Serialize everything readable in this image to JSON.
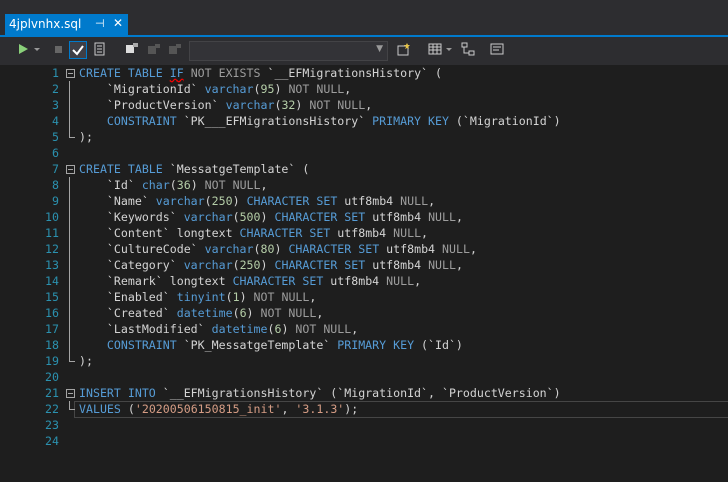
{
  "tab": {
    "title": "4jplvnhx.sql",
    "pin_glyph": "⊣",
    "close_glyph": "✕"
  },
  "toolbar": {
    "icons": [
      "run-icon",
      "run-dropdown-icon",
      "stop-icon",
      "validate-icon",
      "results-icon",
      "connect-icon",
      "disconnect-icon",
      "change-connection-icon",
      "database-combo",
      "new-query-icon",
      "results-grid-icon",
      "execution-plan-icon",
      "properties-icon"
    ],
    "database_combo_value": ""
  },
  "editor": {
    "lines": [
      {
        "n": "1",
        "fold": "start",
        "tokens": [
          [
            "kw",
            "CREATE TABLE "
          ],
          [
            "kw sq",
            "IF"
          ],
          [
            "gr",
            " NOT EXISTS "
          ],
          [
            "tx",
            "`__EFMigrationsHistory`"
          ],
          [
            "tx",
            " ("
          ]
        ]
      },
      {
        "n": "2",
        "fold": "mid",
        "tokens": [
          [
            "tx",
            "    `MigrationId` "
          ],
          [
            "kw",
            "varchar"
          ],
          [
            "tx",
            "("
          ],
          [
            "nm",
            "95"
          ],
          [
            "tx",
            ") "
          ],
          [
            "gr",
            "NOT NULL"
          ],
          [
            "tx",
            ","
          ]
        ]
      },
      {
        "n": "3",
        "fold": "mid",
        "tokens": [
          [
            "tx",
            "    `ProductVersion` "
          ],
          [
            "kw",
            "varchar"
          ],
          [
            "tx",
            "("
          ],
          [
            "nm",
            "32"
          ],
          [
            "tx",
            ") "
          ],
          [
            "gr",
            "NOT NULL"
          ],
          [
            "tx",
            ","
          ]
        ]
      },
      {
        "n": "4",
        "fold": "mid",
        "tokens": [
          [
            "kw",
            "    CONSTRAINT "
          ],
          [
            "tx",
            "`PK___EFMigrationsHistory` "
          ],
          [
            "kw",
            "PRIMARY KEY"
          ],
          [
            "tx",
            " (`MigrationId`)"
          ]
        ]
      },
      {
        "n": "5",
        "fold": "end",
        "tokens": [
          [
            "tx",
            ");"
          ]
        ]
      },
      {
        "n": "6",
        "fold": "",
        "tokens": []
      },
      {
        "n": "7",
        "fold": "start",
        "tokens": [
          [
            "kw",
            "CREATE TABLE "
          ],
          [
            "tx",
            "`MessatgeTemplate` ("
          ]
        ]
      },
      {
        "n": "8",
        "fold": "mid",
        "tokens": [
          [
            "tx",
            "    `Id` "
          ],
          [
            "kw",
            "char"
          ],
          [
            "tx",
            "("
          ],
          [
            "nm",
            "36"
          ],
          [
            "tx",
            ") "
          ],
          [
            "gr",
            "NOT NULL"
          ],
          [
            "tx",
            ","
          ]
        ]
      },
      {
        "n": "9",
        "fold": "mid",
        "tokens": [
          [
            "tx",
            "    `Name` "
          ],
          [
            "kw",
            "varchar"
          ],
          [
            "tx",
            "("
          ],
          [
            "nm",
            "250"
          ],
          [
            "tx",
            ") "
          ],
          [
            "kw",
            "CHARACTER SET"
          ],
          [
            "tx",
            " utf8mb4 "
          ],
          [
            "gr",
            "NULL"
          ],
          [
            "tx",
            ","
          ]
        ]
      },
      {
        "n": "10",
        "fold": "mid",
        "tokens": [
          [
            "tx",
            "    `Keywords` "
          ],
          [
            "kw",
            "varchar"
          ],
          [
            "tx",
            "("
          ],
          [
            "nm",
            "500"
          ],
          [
            "tx",
            ") "
          ],
          [
            "kw",
            "CHARACTER SET"
          ],
          [
            "tx",
            " utf8mb4 "
          ],
          [
            "gr",
            "NULL"
          ],
          [
            "tx",
            ","
          ]
        ]
      },
      {
        "n": "11",
        "fold": "mid",
        "tokens": [
          [
            "tx",
            "    `Content` longtext "
          ],
          [
            "kw",
            "CHARACTER SET"
          ],
          [
            "tx",
            " utf8mb4 "
          ],
          [
            "gr",
            "NULL"
          ],
          [
            "tx",
            ","
          ]
        ]
      },
      {
        "n": "12",
        "fold": "mid",
        "tokens": [
          [
            "tx",
            "    `CultureCode` "
          ],
          [
            "kw",
            "varchar"
          ],
          [
            "tx",
            "("
          ],
          [
            "nm",
            "80"
          ],
          [
            "tx",
            ") "
          ],
          [
            "kw",
            "CHARACTER SET"
          ],
          [
            "tx",
            " utf8mb4 "
          ],
          [
            "gr",
            "NULL"
          ],
          [
            "tx",
            ","
          ]
        ]
      },
      {
        "n": "13",
        "fold": "mid",
        "tokens": [
          [
            "tx",
            "    `Category` "
          ],
          [
            "kw",
            "varchar"
          ],
          [
            "tx",
            "("
          ],
          [
            "nm",
            "250"
          ],
          [
            "tx",
            ") "
          ],
          [
            "kw",
            "CHARACTER SET"
          ],
          [
            "tx",
            " utf8mb4 "
          ],
          [
            "gr",
            "NULL"
          ],
          [
            "tx",
            ","
          ]
        ]
      },
      {
        "n": "14",
        "fold": "mid",
        "tokens": [
          [
            "tx",
            "    `Remark` longtext "
          ],
          [
            "kw",
            "CHARACTER SET"
          ],
          [
            "tx",
            " utf8mb4 "
          ],
          [
            "gr",
            "NULL"
          ],
          [
            "tx",
            ","
          ]
        ]
      },
      {
        "n": "15",
        "fold": "mid",
        "tokens": [
          [
            "tx",
            "    `Enabled` "
          ],
          [
            "kw",
            "tinyint"
          ],
          [
            "tx",
            "("
          ],
          [
            "nm",
            "1"
          ],
          [
            "tx",
            ") "
          ],
          [
            "gr",
            "NOT NULL"
          ],
          [
            "tx",
            ","
          ]
        ]
      },
      {
        "n": "16",
        "fold": "mid",
        "tokens": [
          [
            "tx",
            "    `Created` "
          ],
          [
            "kw",
            "datetime"
          ],
          [
            "tx",
            "("
          ],
          [
            "nm",
            "6"
          ],
          [
            "tx",
            ") "
          ],
          [
            "gr",
            "NOT NULL"
          ],
          [
            "tx",
            ","
          ]
        ]
      },
      {
        "n": "17",
        "fold": "mid",
        "tokens": [
          [
            "tx",
            "    `LastModified` "
          ],
          [
            "kw",
            "datetime"
          ],
          [
            "tx",
            "("
          ],
          [
            "nm",
            "6"
          ],
          [
            "tx",
            ") "
          ],
          [
            "gr",
            "NOT NULL"
          ],
          [
            "tx",
            ","
          ]
        ]
      },
      {
        "n": "18",
        "fold": "mid",
        "tokens": [
          [
            "kw",
            "    CONSTRAINT "
          ],
          [
            "tx",
            "`PK_MessatgeTemplate` "
          ],
          [
            "kw",
            "PRIMARY KEY"
          ],
          [
            "tx",
            " (`Id`)"
          ]
        ]
      },
      {
        "n": "19",
        "fold": "end",
        "tokens": [
          [
            "tx",
            ");"
          ]
        ]
      },
      {
        "n": "20",
        "fold": "",
        "tokens": []
      },
      {
        "n": "21",
        "fold": "start",
        "tokens": [
          [
            "kw",
            "INSERT INTO "
          ],
          [
            "tx",
            "`__EFMigrationsHistory` (`MigrationId`, `ProductVersion`)"
          ]
        ]
      },
      {
        "n": "22",
        "fold": "end",
        "current": true,
        "tokens": [
          [
            "kw",
            "VALUES"
          ],
          [
            "tx",
            " ("
          ],
          [
            "st",
            "'20200506150815_init'"
          ],
          [
            "tx",
            ", "
          ],
          [
            "st",
            "'3.1.3'"
          ],
          [
            "tx",
            ");"
          ]
        ]
      },
      {
        "n": "23",
        "fold": "",
        "tokens": []
      },
      {
        "n": "24",
        "fold": "",
        "tokens": []
      }
    ]
  },
  "colors": {
    "keyword": "#569cd6",
    "gray": "#9d9d9d",
    "string": "#d69d85",
    "number": "#b5cea8",
    "line_number": "#2b91af",
    "accent": "#007acc"
  }
}
